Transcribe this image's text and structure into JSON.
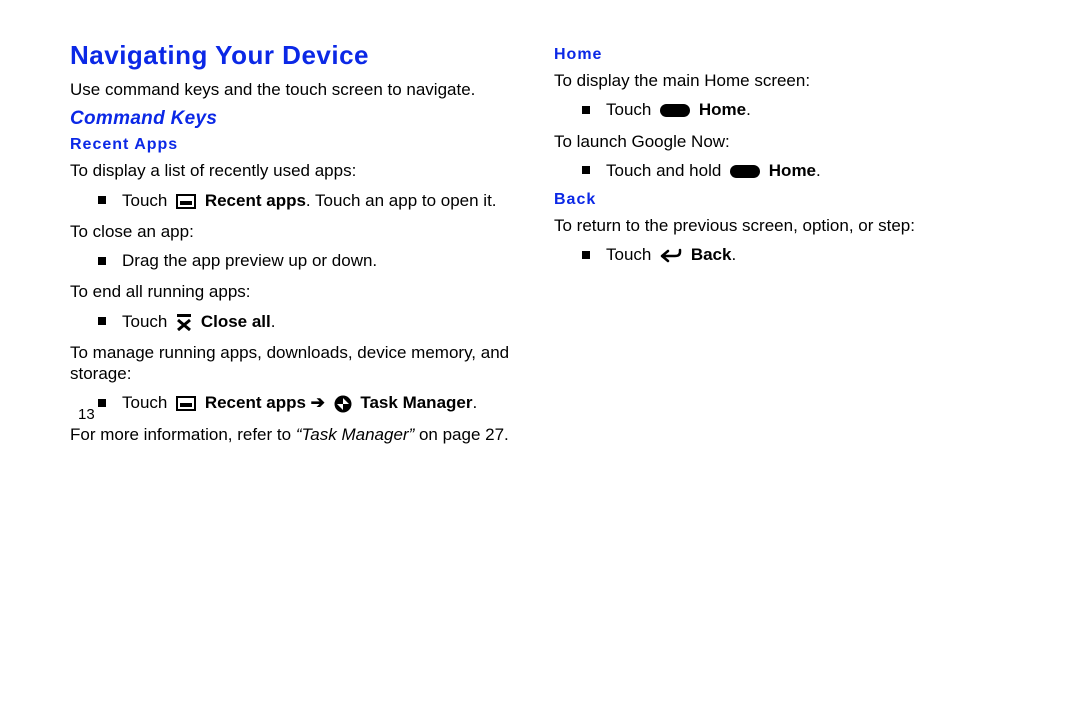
{
  "left": {
    "h1": "Navigating Your Device",
    "intro": "Use command keys and the touch screen to navigate.",
    "h2": "Command Keys",
    "recent": {
      "h3": "Recent Apps",
      "p1": "To display a list of recently used apps:",
      "b1_pre": "Touch ",
      "b1_bold": "Recent apps",
      "b1_post": ". Touch an app to open it.",
      "p2": "To close an app:",
      "b2": "Drag the app preview up or down.",
      "p3": "To end all running apps:",
      "b3_pre": "Touch ",
      "b3_bold": "Close all",
      "b3_post": ".",
      "p4": "To manage running apps, downloads, device memory, and storage:",
      "b4_pre": "Touch ",
      "b4_bold1": "Recent apps",
      "b4_arrow": " ➔ ",
      "b4_bold2": "Task Manager",
      "b4_post": ".",
      "p5_pre": "For more information, refer to ",
      "p5_ital": "“Task Manager”",
      "p5_post": " on page 27."
    }
  },
  "right": {
    "home": {
      "h3": "Home",
      "p1": "To display the main Home screen:",
      "b1_pre": "Touch ",
      "b1_bold": "Home",
      "b1_post": ".",
      "p2": "To launch Google Now:",
      "b2_pre": "Touch and hold ",
      "b2_bold": "Home",
      "b2_post": "."
    },
    "back": {
      "h3": "Back",
      "p1": "To return to the previous screen, option, or step:",
      "b1_pre": "Touch ",
      "b1_bold": "Back",
      "b1_post": "."
    }
  },
  "page_num": "13"
}
